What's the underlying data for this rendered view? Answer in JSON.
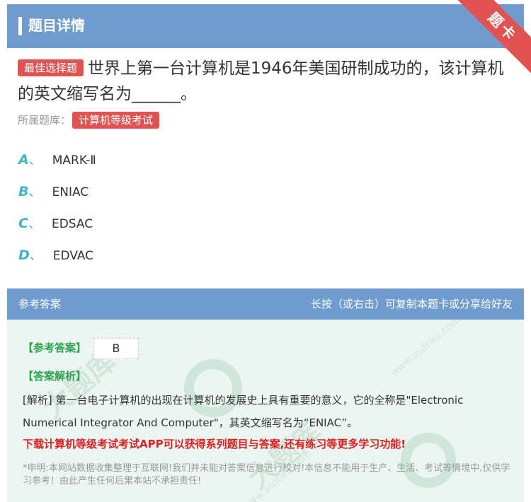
{
  "header": {
    "title": "题目详情",
    "ribbon": "题卡"
  },
  "question": {
    "type_badge": "最佳选择题",
    "text": "世界上第一台计算机是1946年美国研制成功的，该计算机的英文缩写名为______。"
  },
  "category": {
    "label": "所属题库：",
    "value": "计算机等级考试"
  },
  "options": [
    {
      "letter": "A",
      "sep": "、",
      "text": "MARK-Ⅱ"
    },
    {
      "letter": "B",
      "sep": "、",
      "text": "ENIAC"
    },
    {
      "letter": "C",
      "sep": "、",
      "text": "EDSAC"
    },
    {
      "letter": "D",
      "sep": "、",
      "text": "EDVAC"
    }
  ],
  "answer_section": {
    "title": "参考答案",
    "hint": "长按（或右击）可复制本题卡或分享给好友",
    "answer_label": "【参考答案】",
    "answer_value": "B",
    "analysis_label": "【答案解析】",
    "analysis_text": "[解析] 第一台电子计算机的出现在计算机的发展史上具有重要的意义，它的全称是\"Electronic Numerical Integrator And Computer\"，其英文缩写名为“ENIAC”。",
    "promo": "下载计算机等级考试考试APP可以获得系列题目与答案,还有练习等更多学习功能!",
    "disclaimer": "*申明:本网站数据收集整理于互联网!我们并未能对答案信息进行校对!本信息不能用于生产、生活、考试等情境中,仅供学习参考！由此产生任何后果本站不承担责任!"
  },
  "watermark": {
    "text": "大题库",
    "site": "www.asdtiku.com"
  },
  "colors": {
    "header": "#6f9ccf",
    "accent_red": "#e05350",
    "option_letter": "#3fb6c6",
    "answer_green": "#2ea44f",
    "promo_red": "#e02020",
    "answer_bg": "#ebf5f1"
  }
}
